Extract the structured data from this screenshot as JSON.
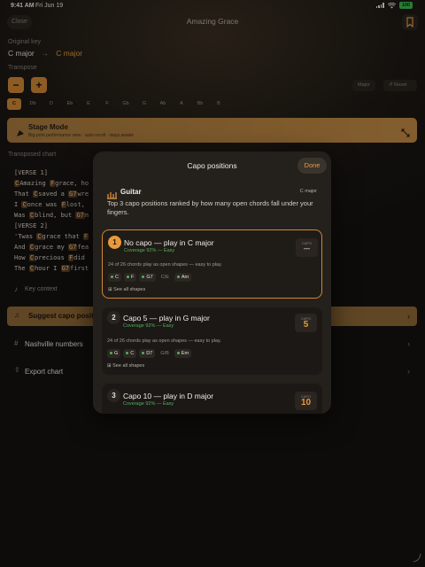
{
  "status": {
    "time": "9:41 AM",
    "date": "Fri Jun 19",
    "battery": "100"
  },
  "header": {
    "close": "Close",
    "title": "Amazing Grace",
    "bookmark_icon": "bookmark-icon"
  },
  "original_key": {
    "label": "Original key",
    "from": "C major",
    "arrow": "→",
    "to": "C major"
  },
  "transpose": {
    "label": "Transpose",
    "minus": "−",
    "plus": "+",
    "mode": "Major",
    "reset": "Reset",
    "keys": [
      "C",
      "Db",
      "D",
      "Eb",
      "E",
      "F",
      "Gb",
      "G",
      "Ab",
      "A",
      "Bb",
      "B"
    ],
    "selected": "C"
  },
  "stage_mode": {
    "title": "Stage Mode",
    "subtitle": "Big-print performance view · auto-scroll · stays awake"
  },
  "chart": {
    "label": "Transposed chart",
    "lines": [
      {
        "t": "[VERSE 1]",
        "h": true
      },
      {
        "parts": [
          [
            "C",
            "c"
          ],
          [
            "Amazing ",
            ""
          ],
          [
            "F",
            "c"
          ],
          [
            "grace, ho",
            ""
          ]
        ]
      },
      {
        "parts": [
          [
            "That ",
            ""
          ],
          [
            "C",
            "c"
          ],
          [
            "saved a ",
            ""
          ],
          [
            "G7",
            "c"
          ],
          [
            "wre",
            ""
          ]
        ]
      },
      {
        "parts": [
          [
            "I ",
            ""
          ],
          [
            "C",
            "c"
          ],
          [
            "once was ",
            ""
          ],
          [
            "F",
            "c"
          ],
          [
            "lost, ",
            ""
          ]
        ]
      },
      {
        "parts": [
          [
            "Was ",
            ""
          ],
          [
            "C",
            "c"
          ],
          [
            "blind, but ",
            ""
          ],
          [
            "G7",
            "c"
          ],
          [
            "n",
            ""
          ]
        ]
      },
      {
        "t": "[VERSE 2]",
        "h": true
      },
      {
        "parts": [
          [
            "'Twas ",
            ""
          ],
          [
            "C",
            "c"
          ],
          [
            "grace that ",
            ""
          ],
          [
            "F",
            "c"
          ]
        ]
      },
      {
        "parts": [
          [
            "And ",
            ""
          ],
          [
            "C",
            "c"
          ],
          [
            "grace my ",
            ""
          ],
          [
            "G7",
            "c"
          ],
          [
            "fea",
            ""
          ]
        ]
      },
      {
        "parts": [
          [
            "How ",
            ""
          ],
          [
            "C",
            "c"
          ],
          [
            "precious ",
            ""
          ],
          [
            "F",
            "c"
          ],
          [
            "did",
            ""
          ]
        ]
      },
      {
        "parts": [
          [
            "The ",
            ""
          ],
          [
            "C",
            "c"
          ],
          [
            "hour I ",
            ""
          ],
          [
            "G7",
            "c"
          ],
          [
            "first",
            ""
          ]
        ]
      }
    ]
  },
  "menu": {
    "key_context": "Key context",
    "suggest_capo": "Suggest capo positions",
    "nashville": "Nashville numbers",
    "export": "Export chart"
  },
  "sheet": {
    "title": "Capo positions",
    "done": "Done",
    "instrument": "Guitar",
    "key": "C major",
    "description": "Top 3 capo positions ranked by how many open chords fall under your fingers.",
    "capo_label": "CAPO",
    "see_all": "See all shapes",
    "positions": [
      {
        "rank": "1",
        "title": "No capo — play in C major",
        "coverage": "Coverage 92% — Easy",
        "capo": "—",
        "desc": "24 of 26 chords play as open shapes — easy to play.",
        "chords": [
          {
            "n": "C",
            "open": true
          },
          {
            "n": "F",
            "open": true
          },
          {
            "n": "G7",
            "open": true
          },
          {
            "n": "C/E",
            "open": false
          },
          {
            "n": "Am",
            "open": true
          }
        ]
      },
      {
        "rank": "2",
        "title": "Capo 5 — play in G major",
        "coverage": "Coverage 92% — Easy",
        "capo": "5",
        "desc": "24 of 26 chords play as open shapes — easy to play.",
        "chords": [
          {
            "n": "G",
            "open": true
          },
          {
            "n": "C",
            "open": true
          },
          {
            "n": "D7",
            "open": true
          },
          {
            "n": "G/B",
            "open": false
          },
          {
            "n": "Em",
            "open": true
          }
        ]
      },
      {
        "rank": "3",
        "title": "Capo 10 — play in D major",
        "coverage": "Coverage 92% — Easy",
        "capo": "10"
      }
    ]
  },
  "colors": {
    "accent": "#E89A3C",
    "easy": "#55B060",
    "sheet": "#24201C"
  }
}
